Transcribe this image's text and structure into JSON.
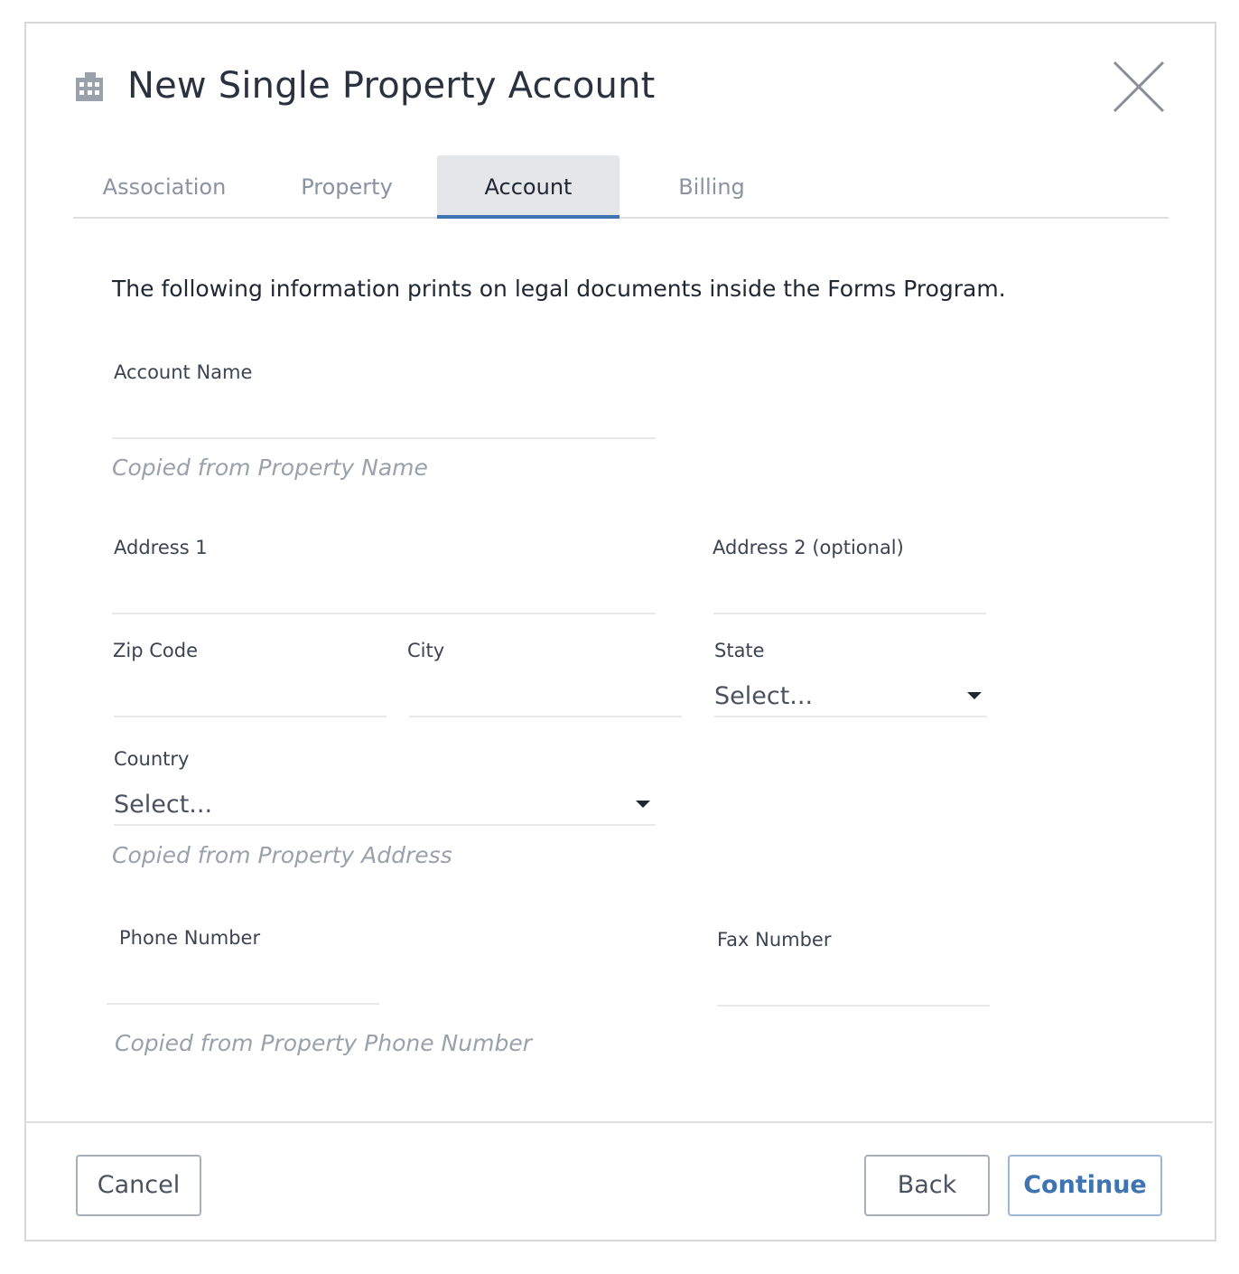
{
  "dialog": {
    "title": "New Single Property Account",
    "header_icon": "building-icon",
    "close_icon": "close-icon"
  },
  "tabs": [
    {
      "label": "Association",
      "active": false
    },
    {
      "label": "Property",
      "active": false
    },
    {
      "label": "Account",
      "active": true
    },
    {
      "label": "Billing",
      "active": false
    }
  ],
  "form": {
    "intro": "The following information prints on legal documents inside the Forms Program.",
    "account_name": {
      "label": "Account Name",
      "value": ""
    },
    "account_name_hint": "Copied from Property Name",
    "address1": {
      "label": "Address 1",
      "value": ""
    },
    "address2": {
      "label": "Address 2 (optional)",
      "value": ""
    },
    "zip": {
      "label": "Zip Code",
      "value": ""
    },
    "city": {
      "label": "City",
      "value": ""
    },
    "state": {
      "label": "State",
      "selected": "Select..."
    },
    "country": {
      "label": "Country",
      "selected": "Select..."
    },
    "address_hint": "Copied from Property Address",
    "phone": {
      "label": "Phone Number",
      "value": ""
    },
    "fax": {
      "label": "Fax Number",
      "value": ""
    },
    "phone_hint": "Copied from Property Phone Number"
  },
  "footer": {
    "cancel_label": "Cancel",
    "back_label": "Back",
    "continue_label": "Continue"
  },
  "colors": {
    "accent": "#3f74b3",
    "active_tab_bg": "#e4e6ea",
    "hint_text": "#9aa1ab"
  }
}
